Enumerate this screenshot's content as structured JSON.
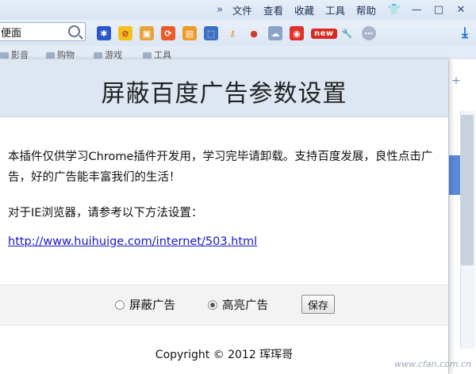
{
  "menu": {
    "items": [
      "文件",
      "查看",
      "收藏",
      "工具",
      "帮助"
    ]
  },
  "toolbar": {
    "search_value": "便面",
    "new_badge": "new"
  },
  "bookmarks": [
    "影音",
    "购物",
    "游戏",
    "工具"
  ],
  "popup": {
    "title": "屏蔽百度广告参数设置",
    "description": "本插件仅供学习Chrome插件开发用，学习完毕请卸载。支持百度发展，良性点击广告，好的广告能丰富我们的生活！",
    "ie_note": "对于IE浏览器，请参考以下方法设置：",
    "link": "http://www.huihuige.com/internet/503.html",
    "options": [
      {
        "label": "屏蔽广告",
        "checked": false
      },
      {
        "label": "高亮广告",
        "checked": true
      }
    ],
    "save_label": "保存",
    "copyright": "Copyright © 2012 珲珲哥"
  },
  "watermark": "www.cfan.com.cn",
  "colors": {
    "header_bg": "#dde6f1",
    "link": "#1a16c4",
    "chrome_bg": "#dfe9f5"
  }
}
